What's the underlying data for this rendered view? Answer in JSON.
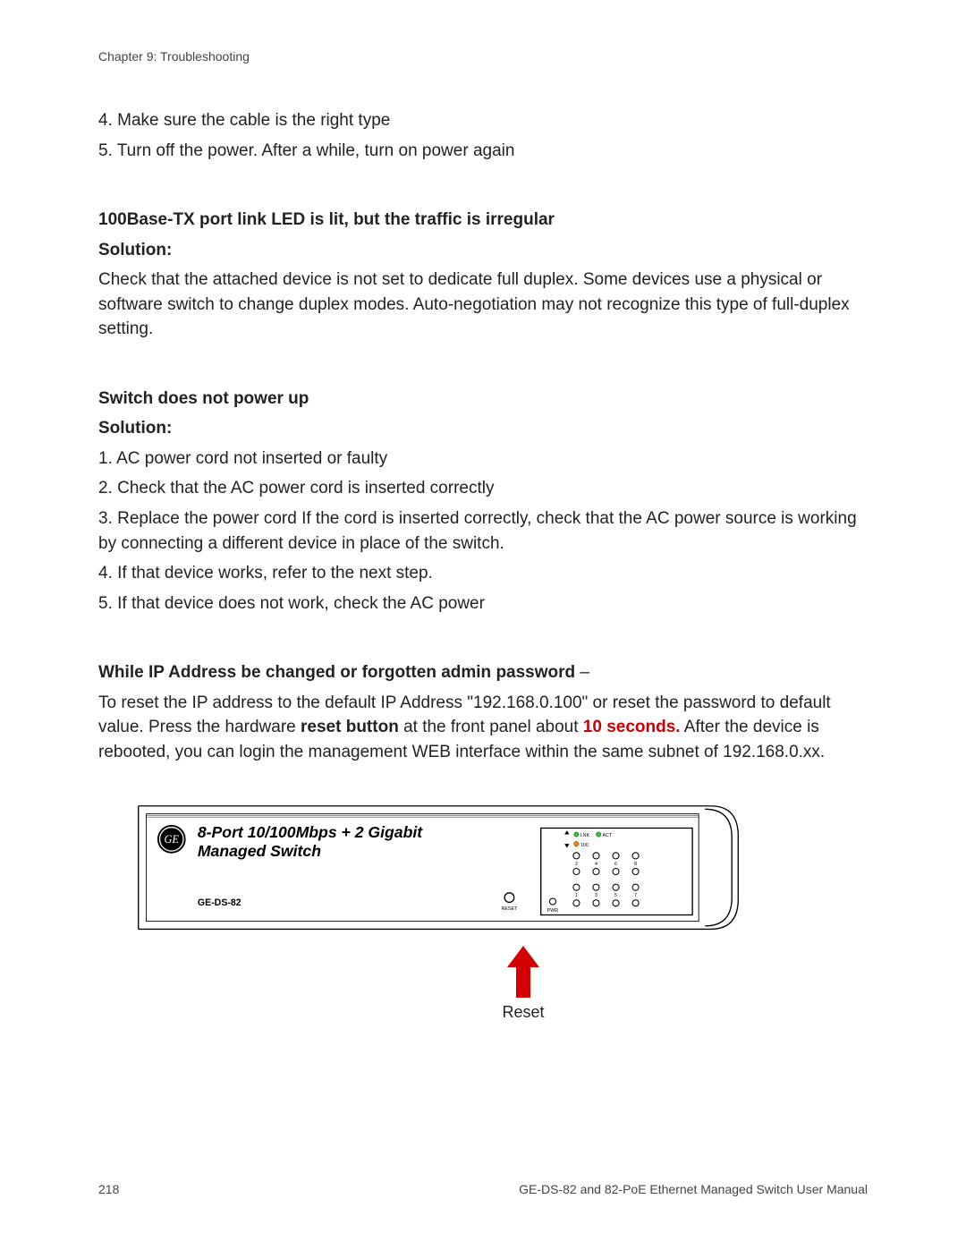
{
  "chapter": "Chapter 9: Troubleshooting",
  "intro_steps": [
    "4. Make sure the cable is the right type",
    "5. Turn off the power. After a while, turn on power again"
  ],
  "section1": {
    "title": "100Base-TX port link LED is lit, but the traffic is irregular",
    "solution_label": "Solution:",
    "text": "Check that the attached device is not set to dedicate full duplex. Some devices use a physical or software switch to change duplex modes. Auto-negotiation may not recognize this type of full-duplex setting."
  },
  "section2": {
    "title": "Switch does not power up",
    "solution_label": "Solution:",
    "steps": [
      "1. AC power cord not inserted or faulty",
      "2. Check that the AC power cord is inserted correctly",
      "3. Replace the power cord If the cord is inserted correctly, check that the AC power source is working by connecting a different device in place of the switch.",
      "4. If that device works, refer to the next step.",
      "5. If that device does not work, check the AC power"
    ]
  },
  "section3": {
    "title_prefix": "While IP Address be changed or forgotten admin password",
    "title_suffix": " –",
    "text_part1": "To reset the IP address to the default IP Address \"192.168.0.100\" or reset the password to default value. Press the hardware ",
    "bold_reset": "reset button",
    "text_part2": " at the front panel about ",
    "red_text": "10 seconds.",
    "text_part3": " After the device is rebooted, you can login the management WEB interface within the same subnet of 192.168.0.xx."
  },
  "device": {
    "title_line1": "8-Port 10/100Mbps + 2 Gigabit",
    "title_line2": "Managed Switch",
    "model": "GE-DS-82",
    "reset_label": "RESET",
    "pwr_label": "PWR",
    "lnk_label": "LNK",
    "act_label": "ACT",
    "speed_label": "100",
    "port_row1": [
      "2",
      "4",
      "6",
      "8"
    ],
    "port_row2": [
      "1",
      "3",
      "5",
      "7"
    ]
  },
  "arrow_label": "Reset",
  "footer": {
    "page_number": "218",
    "doc_title": "GE-DS-82 and 82-PoE Ethernet Managed Switch User Manual"
  }
}
